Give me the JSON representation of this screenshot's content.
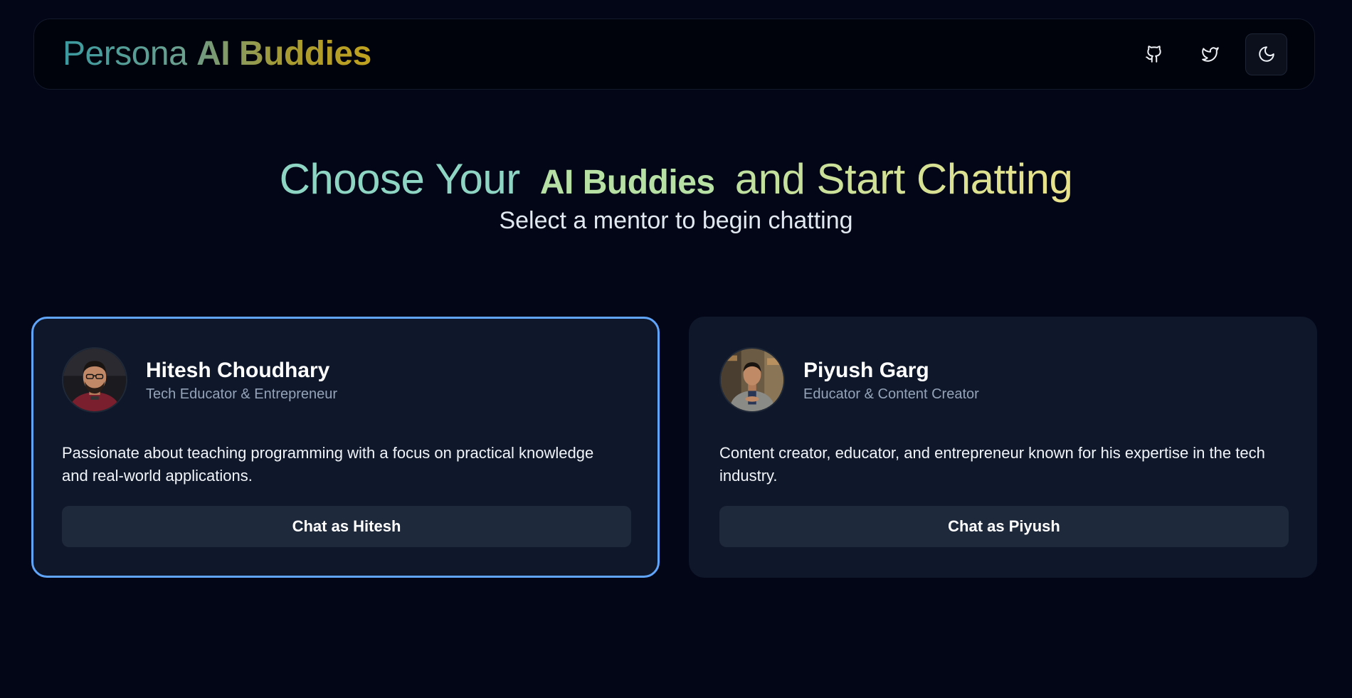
{
  "brand": {
    "part1": "Persona",
    "part2": "AI Buddies"
  },
  "nav": {
    "icons": [
      "github-icon",
      "twitter-icon",
      "moon-icon"
    ]
  },
  "hero": {
    "title_part1": "Choose Your",
    "title_part2": "AI Buddies",
    "title_part3": "and Start Chatting",
    "subtitle": "Select a mentor to begin chatting"
  },
  "mentors": [
    {
      "name": "Hitesh Choudhary",
      "role": "Tech Educator & Entrepreneur",
      "description": "Passionate about teaching programming with a focus on practical knowledge and real-world applications.",
      "button": "Chat as Hitesh",
      "selected": true
    },
    {
      "name": "Piyush Garg",
      "role": "Educator & Content Creator",
      "description": "Content creator, educator, and entrepreneur known for his expertise in the tech industry.",
      "button": "Chat as Piyush",
      "selected": false
    }
  ],
  "colors": {
    "background": "#020617",
    "card": "#0f172a",
    "selected_border": "#60a5fa",
    "button": "#1e293b"
  }
}
